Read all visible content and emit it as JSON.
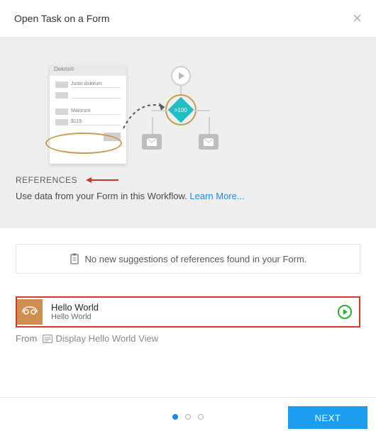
{
  "header": {
    "title": "Open Task on a Form"
  },
  "diagram": {
    "form_title": "Dekris®",
    "row1": "Justo dolorum",
    "row2": "Maiorum",
    "row3_value": "$119",
    "diamond_label": ">100"
  },
  "references": {
    "label": "REFERENCES",
    "subtext": "Use data from your Form in this Workflow.  ",
    "learn_more": "Learn More..."
  },
  "no_suggestions": "No new suggestions of references found in your Form.",
  "task": {
    "title": "Hello World",
    "subtitle": "Hello World"
  },
  "from": {
    "label": "From",
    "source": "Display Hello World View"
  },
  "footer": {
    "next": "NEXT"
  }
}
